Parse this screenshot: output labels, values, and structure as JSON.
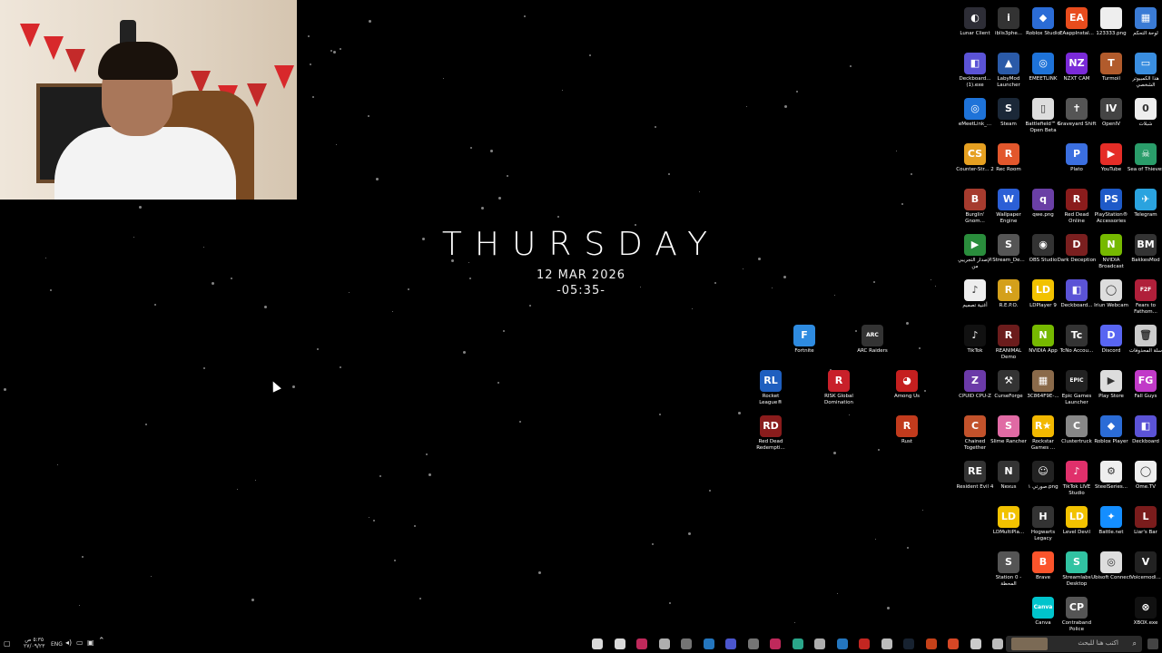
{
  "clock": {
    "day": "THURSDAY",
    "date": "12 MAR 2026",
    "time": "-05:35-"
  },
  "desktop_icons": [
    {
      "label": "Lunar Client",
      "color": "#2d2d36",
      "glyph": "◐"
    },
    {
      "label": "iblis3phe...",
      "color": "#333",
      "glyph": "i"
    },
    {
      "label": "Roblox Studio",
      "color": "#2b6cd6",
      "glyph": "◆"
    },
    {
      "label": "EAappInstal...",
      "color": "#e84c1d",
      "glyph": "EA"
    },
    {
      "label": "123333.png",
      "color": "#eee",
      "glyph": ""
    },
    {
      "label": "لوحة التحكم",
      "color": "#3a7bd5",
      "glyph": "▦"
    },
    {
      "label": "Deckboard... (1).exe",
      "color": "#5b53d6",
      "glyph": "◧"
    },
    {
      "label": "LabyMod Launcher",
      "color": "#2a5aa8",
      "glyph": "▲"
    },
    {
      "label": "EMEETLINK",
      "color": "#1e73d9",
      "glyph": "◎"
    },
    {
      "label": "NZXT CAM",
      "color": "#7a2ad8",
      "glyph": "NZ"
    },
    {
      "label": "Turmoil",
      "color": "#b15b2c",
      "glyph": "T"
    },
    {
      "label": "هذا الكمبيوتر الشخصي",
      "color": "#3a8ee0",
      "glyph": "▭"
    },
    {
      "label": "eMeetLink_...",
      "color": "#1e73d9",
      "glyph": "◎"
    },
    {
      "label": "Steam",
      "color": "#1b2838",
      "glyph": "S"
    },
    {
      "label": "Battlefield™ 6 Open Beta",
      "color": "#ddd",
      "glyph": "▯"
    },
    {
      "label": "Graveyard Shift",
      "color": "#555",
      "glyph": "✝"
    },
    {
      "label": "OpenIV",
      "color": "#444",
      "glyph": "IV"
    },
    {
      "label": "شبلات",
      "color": "#eee",
      "glyph": "0"
    },
    {
      "label": "Counter-Str... 2",
      "color": "#e6a021",
      "glyph": "CS"
    },
    {
      "label": "Rec Room",
      "color": "#e2572c",
      "glyph": "R"
    },
    {
      "label": "Plato",
      "color": "#3b6fe0",
      "glyph": "P"
    },
    {
      "label": "YouTube",
      "color": "#e52d27",
      "glyph": "▶"
    },
    {
      "label": "Sea of Thieves",
      "color": "#2a9d6a",
      "glyph": "☠"
    },
    {
      "label": "Burglin' Gnom...",
      "color": "#a63b2e",
      "glyph": "B"
    },
    {
      "label": "Wallpaper Engine",
      "color": "#2b5fd6",
      "glyph": "W"
    },
    {
      "label": "qwe.png",
      "color": "#6a3fa5",
      "glyph": "q"
    },
    {
      "label": "Red Dead Online",
      "color": "#8a1c1c",
      "glyph": "R"
    },
    {
      "label": "PlayStation® Accessories",
      "color": "#1e5ac8",
      "glyph": "PS"
    },
    {
      "label": "Telegram",
      "color": "#2aa3df",
      "glyph": "✈"
    },
    {
      "label": "الإصدار التجريبي من",
      "color": "#2a8d3c",
      "glyph": "▶"
    },
    {
      "label": "Stream_De...",
      "color": "#555",
      "glyph": "S"
    },
    {
      "label": "OBS Studio",
      "color": "#333",
      "glyph": "◉"
    },
    {
      "label": "Dark Deception",
      "color": "#7a1f1f",
      "glyph": "D"
    },
    {
      "label": "NVIDIA Broadcast",
      "color": "#76b900",
      "glyph": "N"
    },
    {
      "label": "BakkesMod",
      "color": "#333",
      "glyph": "BM"
    },
    {
      "label": "أغنية تصميم",
      "color": "#eee",
      "glyph": "♪"
    },
    {
      "label": "R.E.P.O.",
      "color": "#d4a01b",
      "glyph": "R"
    },
    {
      "label": "LDPlayer 9",
      "color": "#f2c200",
      "glyph": "LD"
    },
    {
      "label": "Deckboard...",
      "color": "#5b53d6",
      "glyph": "◧"
    },
    {
      "label": "Iriun Webcam",
      "color": "#ddd",
      "glyph": "◯"
    },
    {
      "label": "Fears to Fathom...",
      "color": "#b01f3a",
      "glyph": "F2F"
    },
    {
      "label": "Fortnite",
      "color": "#2e8be0",
      "glyph": "F"
    },
    {
      "label": "ARC Raiders",
      "color": "#333",
      "glyph": "ARC"
    },
    {
      "label": "TikTok",
      "color": "#111",
      "glyph": "♪"
    },
    {
      "label": "REANIMAL Demo",
      "color": "#6b1c1c",
      "glyph": "R"
    },
    {
      "label": "NVIDIA App",
      "color": "#76b900",
      "glyph": "N"
    },
    {
      "label": "TcNo Accou...",
      "color": "#333",
      "glyph": "Tc"
    },
    {
      "label": "Discord",
      "color": "#5865f2",
      "glyph": "D"
    },
    {
      "label": "سلة المحذوفات",
      "color": "#ccc",
      "glyph": "🗑"
    },
    {
      "label": "Rocket League®",
      "color": "#1f5fbf",
      "glyph": "RL"
    },
    {
      "label": "RISK Global Domination",
      "color": "#c8202a",
      "glyph": "R"
    },
    {
      "label": "Among Us",
      "color": "#c51f1f",
      "glyph": "◕"
    },
    {
      "label": "CPUID CPU-Z",
      "color": "#6b3aa8",
      "glyph": "Z"
    },
    {
      "label": "CurseForge",
      "color": "#333",
      "glyph": "⚒"
    },
    {
      "label": "3C864F9E-...",
      "color": "#8a6a4a",
      "glyph": "▦"
    },
    {
      "label": "Epic Games Launcher",
      "color": "#222",
      "glyph": "EPIC"
    },
    {
      "label": "Play Store",
      "color": "#ddd",
      "glyph": "▶"
    },
    {
      "label": "Fall Guys",
      "color": "#c13ac8",
      "glyph": "FG"
    },
    {
      "label": "Red Dead Redempti...",
      "color": "#8a1c1c",
      "glyph": "RD"
    },
    {
      "label": "Rust",
      "color": "#c23b1d",
      "glyph": "R"
    },
    {
      "label": "Chained Together",
      "color": "#c2522b",
      "glyph": "C"
    },
    {
      "label": "Slime Rancher",
      "color": "#e06aa4",
      "glyph": "S"
    },
    {
      "label": "Rockstar Games ...",
      "color": "#f2b800",
      "glyph": "R★"
    },
    {
      "label": "Clustertruck",
      "color": "#888",
      "glyph": "C"
    },
    {
      "label": "Roblox Player",
      "color": "#2b6cd6",
      "glyph": "◆"
    },
    {
      "label": "Deckboard",
      "color": "#5b53d6",
      "glyph": "◧"
    },
    {
      "label": "Resident Evil 4",
      "color": "#333",
      "glyph": "RE"
    },
    {
      "label": "Nexus",
      "color": "#333",
      "glyph": "N"
    },
    {
      "label": "صورتي ١.png",
      "color": "#222",
      "glyph": "☺"
    },
    {
      "label": "TikTok LIVE Studio",
      "color": "#e0306b",
      "glyph": "♪"
    },
    {
      "label": "SteelSeries...",
      "color": "#eee",
      "glyph": "⚙"
    },
    {
      "label": "Ome.TV",
      "color": "#eee",
      "glyph": "◯"
    },
    {
      "label": "LDMultiPla...",
      "color": "#f2c200",
      "glyph": "LD"
    },
    {
      "label": "Hogwarts Legacy",
      "color": "#333",
      "glyph": "H"
    },
    {
      "label": "Level Devil",
      "color": "#f2c200",
      "glyph": "LD"
    },
    {
      "label": "Battle.net",
      "color": "#148eff",
      "glyph": "✦"
    },
    {
      "label": "Liar's Bar",
      "color": "#7a1c1c",
      "glyph": "L"
    },
    {
      "label": "Station 0 - المحطة",
      "color": "#555",
      "glyph": "S"
    },
    {
      "label": "Brave",
      "color": "#fb542b",
      "glyph": "B"
    },
    {
      "label": "Streamlabs Desktop",
      "color": "#31c3a2",
      "glyph": "S"
    },
    {
      "label": "Ubisoft Connect",
      "color": "#ddd",
      "glyph": "◎"
    },
    {
      "label": "Voicemodi...",
      "color": "#222",
      "glyph": "V"
    },
    {
      "label": "Canva",
      "color": "#00c4cc",
      "glyph": "Canva"
    },
    {
      "label": "Contraband Police",
      "color": "#555",
      "glyph": "CP"
    },
    {
      "label": "XBOX.exe",
      "color": "#111",
      "glyph": "⊗"
    }
  ],
  "taskbar": {
    "search_placeholder": "اكتب هنا للبحث",
    "language": "ENG",
    "time": "٥:٣٥ ص",
    "date": "٢٧/٠٩/٢٣"
  }
}
